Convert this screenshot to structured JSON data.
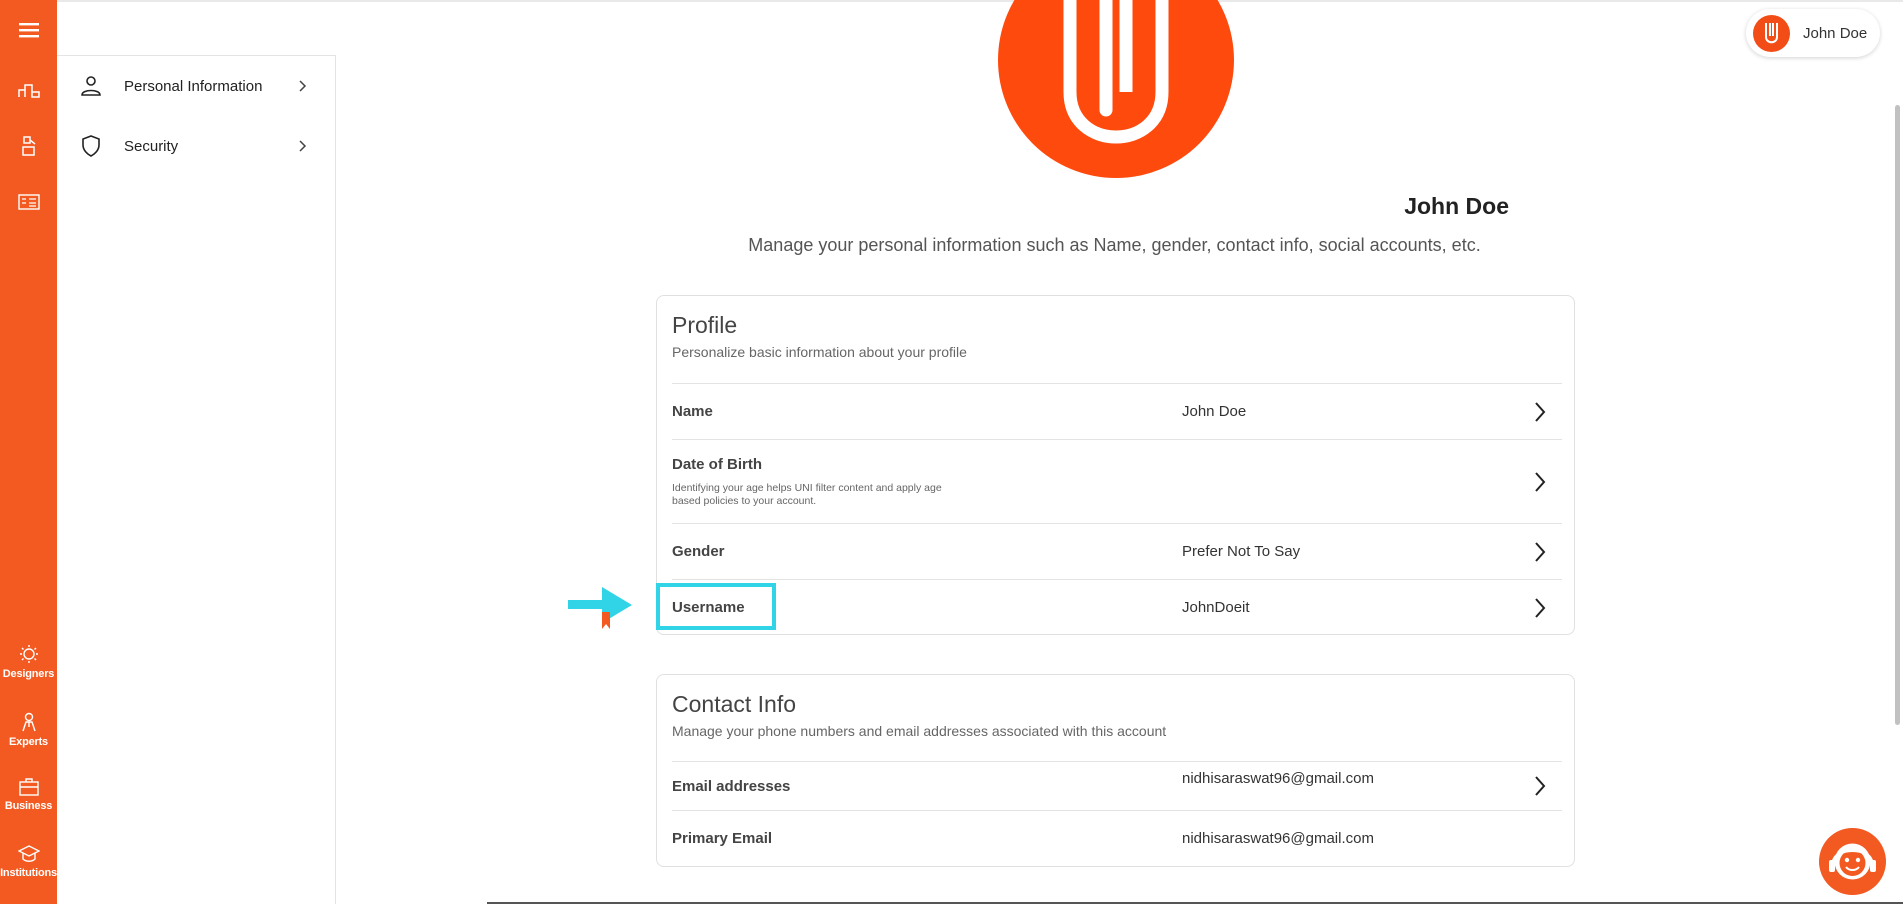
{
  "header": {
    "user_name": "John Doe"
  },
  "rail": {
    "items": [
      {
        "label": "Designers",
        "icon": "designers-icon"
      },
      {
        "label": "Experts",
        "icon": "experts-icon"
      },
      {
        "label": "Business",
        "icon": "business-icon"
      },
      {
        "label": "Institutions",
        "icon": "institutions-icon"
      }
    ]
  },
  "subnav": {
    "items": [
      {
        "label": "Personal Information",
        "icon": "person-icon"
      },
      {
        "label": "Security",
        "icon": "shield-icon"
      }
    ]
  },
  "profile": {
    "name": "John Doe",
    "subtitle": "Manage your personal information such as Name, gender, contact info, social accounts, etc."
  },
  "profile_card": {
    "title": "Profile",
    "description": "Personalize basic information about your profile",
    "rows": [
      {
        "label": "Name",
        "value": "John Doe"
      },
      {
        "label": "Date of Birth",
        "note": "Identifying your age helps UNI filter content and apply age based policies to your account.",
        "value": ""
      },
      {
        "label": "Gender",
        "value": "Prefer Not To Say"
      },
      {
        "label": "Username",
        "value": "JohnDoeit"
      }
    ]
  },
  "contact_card": {
    "title": "Contact Info",
    "description": "Manage your phone numbers and email addresses associated with this account",
    "rows": [
      {
        "label": "Email addresses",
        "value": "nidhisaraswat96@gmail.com"
      },
      {
        "label": "Primary Email",
        "value": "nidhisaraswat96@gmail.com"
      }
    ]
  },
  "colors": {
    "accent": "#f25a22",
    "avatar": "#ff4a0e",
    "highlight": "#30d4e6"
  }
}
